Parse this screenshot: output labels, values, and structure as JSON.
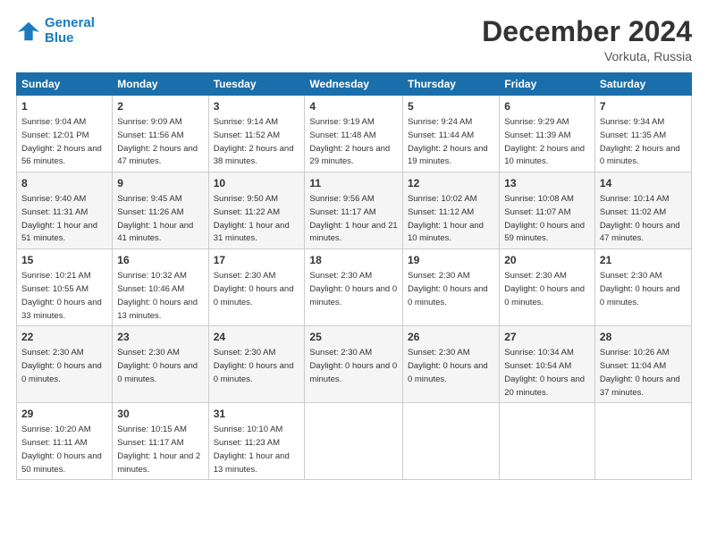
{
  "logo": {
    "line1": "General",
    "line2": "Blue"
  },
  "title": "December 2024",
  "location": "Vorkuta, Russia",
  "days_of_week": [
    "Sunday",
    "Monday",
    "Tuesday",
    "Wednesday",
    "Thursday",
    "Friday",
    "Saturday"
  ],
  "weeks": [
    [
      {
        "day": "1",
        "info": "Sunrise: 9:04 AM\nSunset: 12:01 PM\nDaylight: 2 hours and 56 minutes."
      },
      {
        "day": "2",
        "info": "Sunrise: 9:09 AM\nSunset: 11:56 AM\nDaylight: 2 hours and 47 minutes."
      },
      {
        "day": "3",
        "info": "Sunrise: 9:14 AM\nSunset: 11:52 AM\nDaylight: 2 hours and 38 minutes."
      },
      {
        "day": "4",
        "info": "Sunrise: 9:19 AM\nSunset: 11:48 AM\nDaylight: 2 hours and 29 minutes."
      },
      {
        "day": "5",
        "info": "Sunrise: 9:24 AM\nSunset: 11:44 AM\nDaylight: 2 hours and 19 minutes."
      },
      {
        "day": "6",
        "info": "Sunrise: 9:29 AM\nSunset: 11:39 AM\nDaylight: 2 hours and 10 minutes."
      },
      {
        "day": "7",
        "info": "Sunrise: 9:34 AM\nSunset: 11:35 AM\nDaylight: 2 hours and 0 minutes."
      }
    ],
    [
      {
        "day": "8",
        "info": "Sunrise: 9:40 AM\nSunset: 11:31 AM\nDaylight: 1 hour and 51 minutes."
      },
      {
        "day": "9",
        "info": "Sunrise: 9:45 AM\nSunset: 11:26 AM\nDaylight: 1 hour and 41 minutes."
      },
      {
        "day": "10",
        "info": "Sunrise: 9:50 AM\nSunset: 11:22 AM\nDaylight: 1 hour and 31 minutes."
      },
      {
        "day": "11",
        "info": "Sunrise: 9:56 AM\nSunset: 11:17 AM\nDaylight: 1 hour and 21 minutes."
      },
      {
        "day": "12",
        "info": "Sunrise: 10:02 AM\nSunset: 11:12 AM\nDaylight: 1 hour and 10 minutes."
      },
      {
        "day": "13",
        "info": "Sunrise: 10:08 AM\nSunset: 11:07 AM\nDaylight: 0 hours and 59 minutes."
      },
      {
        "day": "14",
        "info": "Sunrise: 10:14 AM\nSunset: 11:02 AM\nDaylight: 0 hours and 47 minutes."
      }
    ],
    [
      {
        "day": "15",
        "info": "Sunrise: 10:21 AM\nSunset: 10:55 AM\nDaylight: 0 hours and 33 minutes."
      },
      {
        "day": "16",
        "info": "Sunrise: 10:32 AM\nSunset: 10:46 AM\nDaylight: 0 hours and 13 minutes."
      },
      {
        "day": "17",
        "info": "Sunset: 2:30 AM\nDaylight: 0 hours and 0 minutes."
      },
      {
        "day": "18",
        "info": "Sunset: 2:30 AM\nDaylight: 0 hours and 0 minutes."
      },
      {
        "day": "19",
        "info": "Sunset: 2:30 AM\nDaylight: 0 hours and 0 minutes."
      },
      {
        "day": "20",
        "info": "Sunset: 2:30 AM\nDaylight: 0 hours and 0 minutes."
      },
      {
        "day": "21",
        "info": "Sunset: 2:30 AM\nDaylight: 0 hours and 0 minutes."
      }
    ],
    [
      {
        "day": "22",
        "info": "Sunset: 2:30 AM\nDaylight: 0 hours and 0 minutes."
      },
      {
        "day": "23",
        "info": "Sunset: 2:30 AM\nDaylight: 0 hours and 0 minutes."
      },
      {
        "day": "24",
        "info": "Sunset: 2:30 AM\nDaylight: 0 hours and 0 minutes."
      },
      {
        "day": "25",
        "info": "Sunset: 2:30 AM\nDaylight: 0 hours and 0 minutes."
      },
      {
        "day": "26",
        "info": "Sunset: 2:30 AM\nDaylight: 0 hours and 0 minutes."
      },
      {
        "day": "27",
        "info": "Sunrise: 10:34 AM\nSunset: 10:54 AM\nDaylight: 0 hours and 20 minutes."
      },
      {
        "day": "28",
        "info": "Sunrise: 10:26 AM\nSunset: 11:04 AM\nDaylight: 0 hours and 37 minutes."
      }
    ],
    [
      {
        "day": "29",
        "info": "Sunrise: 10:20 AM\nSunset: 11:11 AM\nDaylight: 0 hours and 50 minutes."
      },
      {
        "day": "30",
        "info": "Sunrise: 10:15 AM\nSunset: 11:17 AM\nDaylight: 1 hour and 2 minutes."
      },
      {
        "day": "31",
        "info": "Sunrise: 10:10 AM\nSunset: 11:23 AM\nDaylight: 1 hour and 13 minutes."
      },
      null,
      null,
      null,
      null
    ]
  ]
}
